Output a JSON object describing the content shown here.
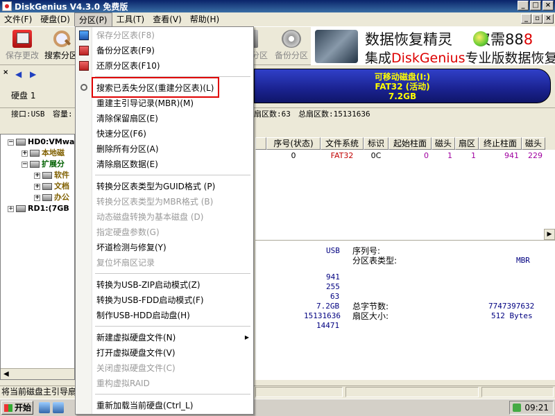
{
  "window": {
    "title": "DiskGenius V4.3.0 免费版",
    "buttons": {
      "minimize": "_",
      "maximize": "□",
      "close": "×"
    }
  },
  "menubar": {
    "items": [
      "文件(F)",
      "硬盘(D)",
      "分区(P)",
      "工具(T)",
      "查看(V)",
      "帮助(H)"
    ],
    "mdi": {
      "minimize": "_",
      "restore": "▫",
      "close": "×"
    }
  },
  "toolbar": {
    "save": "保存更改",
    "search": "搜索分区",
    "partition_partial": "分区",
    "backup": "备份分区",
    "banner": {
      "line1_a": "数据恢复精灵",
      "line1_b": "仅需88",
      "line2_a": "集成",
      "line2_b": "DiskGenius",
      "line2_c": "专业版数据恢复内"
    }
  },
  "disk": {
    "close_glyph": "×",
    "nav_arrows": "◀ ▶",
    "label": "硬盘 1",
    "bar": {
      "line1": "可移动磁盘(I:)",
      "line2": "FAT32 (活动)",
      "line3": "7.2GB"
    },
    "info": {
      "interface": "接口:USB",
      "capacity": "容量:",
      "sectors_per_track": "扇区数:63",
      "total_sectors": "总扇区数:15131636"
    }
  },
  "tree": {
    "items": [
      {
        "label": "HD0:VMwa",
        "exp": "−"
      },
      {
        "label": "本地磁",
        "exp": "+"
      },
      {
        "label": "扩展分",
        "exp": "−"
      },
      {
        "label": "软件",
        "exp": "+"
      },
      {
        "label": "文档",
        "exp": "+"
      },
      {
        "label": "办公",
        "exp": "+"
      },
      {
        "label": "RD1:(7GB",
        "exp": "+"
      }
    ],
    "scroll_left": "◀",
    "scroll_right": "▶"
  },
  "partition_table": {
    "headers": [
      "序号(状态)",
      "文件系统",
      "标识",
      "起始柱面",
      "磁头",
      "扇区",
      "终止柱面",
      "磁头"
    ],
    "rows": [
      [
        "0",
        "FAT32",
        "0C",
        "0",
        "1",
        "1",
        "941",
        "229"
      ]
    ],
    "scroll_right": "▶"
  },
  "info_panel": {
    "interface_value": "USB",
    "serial_label": "序列号:",
    "table_type_label": "分区表类型:",
    "table_type_value": "MBR",
    "cylinders": "941",
    "heads": "255",
    "sectors": "63",
    "capacity": "7.2GB",
    "total_bytes_label": "总字节数:",
    "total_bytes_value": "7747397632",
    "total_sectors": "15131636",
    "sector_size_label": "扇区大小:",
    "sector_size_value": "512 Bytes",
    "extra": "14471"
  },
  "statusbar": {
    "text": "将当前磁盘主引导扇"
  },
  "taskbar": {
    "start": "开始",
    "clock": "09:21"
  },
  "partition_menu": {
    "items": [
      {
        "label": "保存分区表(F8)",
        "disabled": true
      },
      {
        "label": "备份分区表(F9)",
        "disabled": false
      },
      {
        "label": "还原分区表(F10)",
        "disabled": false
      },
      {
        "label": "搜索已丢失分区(重建分区表)(L)",
        "disabled": false
      },
      {
        "label": "重建主引导记录(MBR)(M)",
        "disabled": false
      },
      {
        "label": "清除保留扇区(E)",
        "disabled": false
      },
      {
        "label": "快速分区(F6)",
        "disabled": false
      },
      {
        "label": "删除所有分区(A)",
        "disabled": false
      },
      {
        "label": "清除扇区数据(E)",
        "disabled": false
      },
      {
        "label": "转换分区表类型为GUID格式 (P)",
        "disabled": false
      },
      {
        "label": "转换分区表类型为MBR格式 (B)",
        "disabled": true
      },
      {
        "label": "动态磁盘转换为基本磁盘 (D)",
        "disabled": true
      },
      {
        "label": "指定硬盘参数(G)",
        "disabled": true
      },
      {
        "label": "坏道检测与修复(Y)",
        "disabled": false
      },
      {
        "label": "复位坏扇区记录",
        "disabled": true
      },
      {
        "label": "转换为USB-ZIP启动模式(Z)",
        "disabled": false
      },
      {
        "label": "转换为USB-FDD启动模式(F)",
        "disabled": false
      },
      {
        "label": "制作USB-HDD启动盘(H)",
        "disabled": false
      },
      {
        "label": "新建虚拟硬盘文件(N)",
        "disabled": false
      },
      {
        "label": "打开虚拟硬盘文件(V)",
        "disabled": false
      },
      {
        "label": "关闭虚拟硬盘文件(C)",
        "disabled": true
      },
      {
        "label": "重构虚拟RAID",
        "disabled": true
      },
      {
        "label": "重新加载当前硬盘(Ctrl_L)",
        "disabled": false
      }
    ],
    "submenu_arrow": "▶"
  },
  "colors": {
    "title_bar": "#0a246a",
    "disk_bar": "#1a2290",
    "disk_bar_text": "#ffff00",
    "highlight": "#e00000",
    "selection": "#316ac5"
  }
}
